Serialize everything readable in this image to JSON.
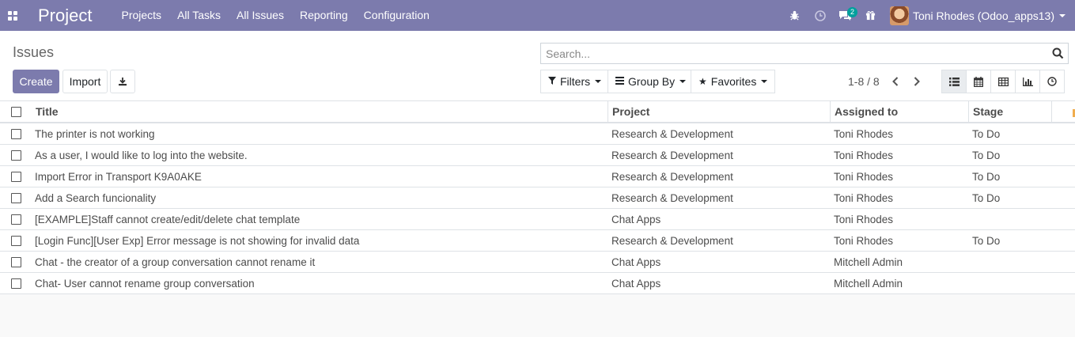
{
  "navbar": {
    "brand": "Project",
    "menu": [
      "Projects",
      "All Tasks",
      "All Issues",
      "Reporting",
      "Configuration"
    ],
    "message_count": "2",
    "user_name": "Toni Rhodes (Odoo_apps13)"
  },
  "control_panel": {
    "breadcrumb": "Issues",
    "create_label": "Create",
    "import_label": "Import",
    "search_placeholder": "Search...",
    "filters_label": "Filters",
    "group_by_label": "Group By",
    "favorites_label": "Favorites",
    "pager_text": "1-8 / 8"
  },
  "table": {
    "headers": {
      "title": "Title",
      "project": "Project",
      "assigned": "Assigned to",
      "stage": "Stage"
    },
    "rows": [
      {
        "title": "The printer is not working",
        "project": "Research & Development",
        "assigned": "Toni Rhodes",
        "stage": "To Do"
      },
      {
        "title": "As a user, I would like to log into the website.",
        "project": "Research & Development",
        "assigned": "Toni Rhodes",
        "stage": "To Do"
      },
      {
        "title": "Import Error in Transport K9A0AKE",
        "project": "Research & Development",
        "assigned": "Toni Rhodes",
        "stage": "To Do"
      },
      {
        "title": "Add a Search funcionality",
        "project": "Research & Development",
        "assigned": "Toni Rhodes",
        "stage": "To Do"
      },
      {
        "title": "[EXAMPLE]Staff cannot create/edit/delete chat template",
        "project": "Chat Apps",
        "assigned": "Toni Rhodes",
        "stage": ""
      },
      {
        "title": "[Login Func][User Exp] Error message is not showing for invalid data",
        "project": "Research & Development",
        "assigned": "Toni Rhodes",
        "stage": "To Do"
      },
      {
        "title": "Chat - the creator of a group conversation cannot rename it",
        "project": "Chat Apps",
        "assigned": "Mitchell Admin",
        "stage": ""
      },
      {
        "title": "Chat- User cannot rename group conversation",
        "project": "Chat Apps",
        "assigned": "Mitchell Admin",
        "stage": ""
      }
    ]
  }
}
